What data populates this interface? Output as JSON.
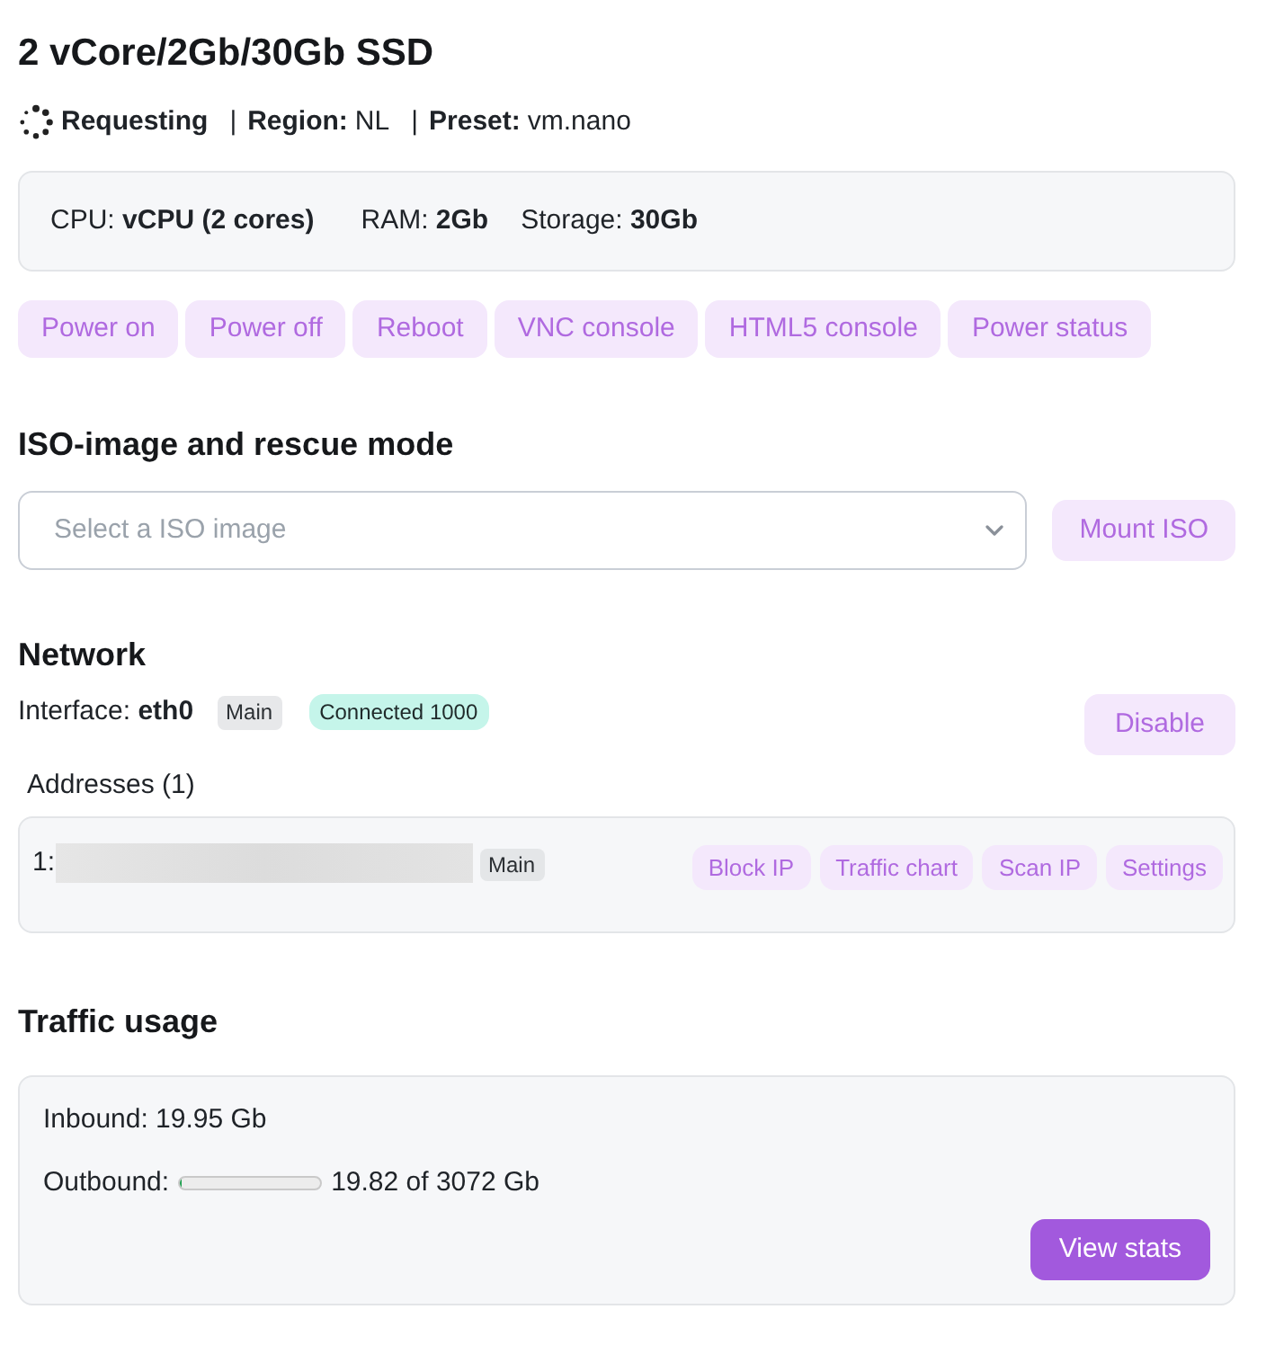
{
  "title": "2 vCore/2Gb/30Gb SSD",
  "status": {
    "busy": true,
    "state": "Requesting",
    "meta": [
      {
        "separator": "|",
        "label": "Region:",
        "value": "NL"
      },
      {
        "separator": "|",
        "label": "Preset:",
        "value": "vm.nano"
      }
    ]
  },
  "specs": [
    {
      "label": "CPU:",
      "value": "vCPU (2 cores)"
    },
    {
      "label": "RAM:",
      "value": "2Gb"
    },
    {
      "label": "Storage:",
      "value": "30Gb"
    }
  ],
  "actions": [
    "Power on",
    "Power off",
    "Reboot",
    "VNC console",
    "HTML5 console",
    "Power status"
  ],
  "iso": {
    "heading": "ISO-image and rescue mode",
    "select": {
      "placeholder": "Select a ISO image"
    },
    "button": "Mount ISO"
  },
  "network": {
    "heading": "Network",
    "interface": {
      "label": "Interface:",
      "name": "eth0",
      "badges": [
        {
          "text": "Main",
          "kind": "neutral"
        },
        {
          "text": "Connected 1000",
          "kind": "success"
        }
      ],
      "button": "Disable"
    },
    "addresses_heading": "Addresses (1)",
    "addresses": [
      {
        "index": "1:",
        "redacted": true,
        "badge": "Main",
        "actions": [
          "Block IP",
          "Traffic chart",
          "Scan IP",
          "Settings"
        ]
      }
    ]
  },
  "traffic": {
    "heading": "Traffic usage",
    "inbound": {
      "label": "Inbound:",
      "value": "19.95 Gb"
    },
    "outbound": {
      "label": "Outbound:",
      "level": 0.0065,
      "reading": "19.82 of 3072 Gb"
    },
    "button": "View stats"
  }
}
